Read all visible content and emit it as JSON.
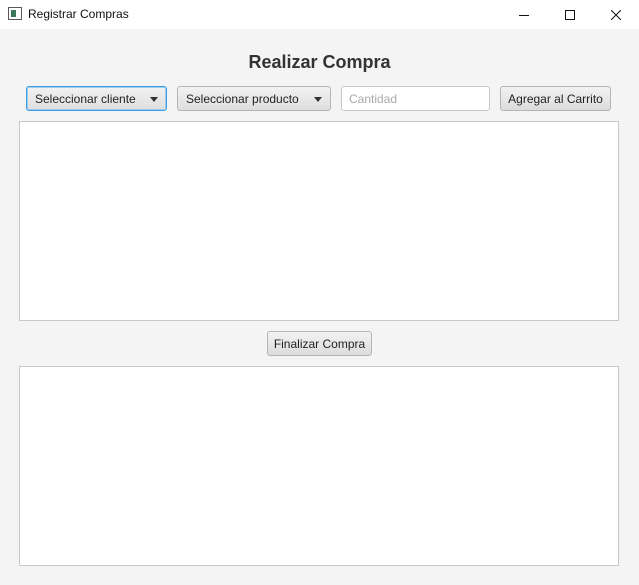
{
  "window": {
    "title": "Registrar Compras"
  },
  "main": {
    "heading": "Realizar Compra",
    "client_select": {
      "selected": "Seleccionar cliente"
    },
    "product_select": {
      "selected": "Seleccionar producto"
    },
    "quantity_input": {
      "value": "",
      "placeholder": "Cantidad"
    },
    "add_button_label": "Agregar al Carrito",
    "finish_button_label": "Finalizar Compra",
    "cart_items": [],
    "purchase_summary": []
  },
  "colors": {
    "focus_border": "#3a9be0",
    "window_background": "#f4f4f4"
  }
}
